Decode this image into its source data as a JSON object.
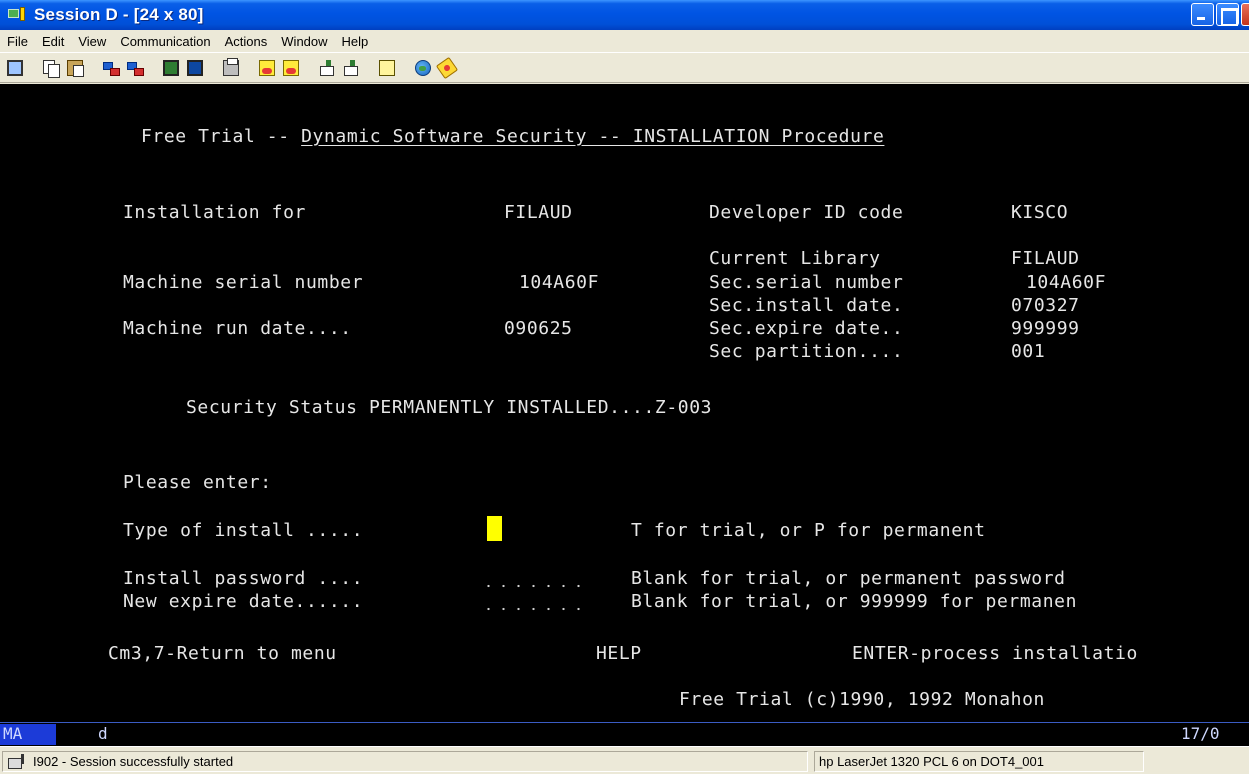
{
  "window": {
    "title": "Session D - [24 x 80]",
    "colors": {
      "titlebar": "#0054e3",
      "terminal_bg": "#000000",
      "terminal_fg": "#e6e6e6",
      "cursor": "#ffff00",
      "oia_highlight": "#1c3bd8"
    }
  },
  "menu": [
    "File",
    "Edit",
    "View",
    "Communication",
    "Actions",
    "Window",
    "Help"
  ],
  "toolbar": {
    "icons": [
      "monitor-icon",
      "copy-icon",
      "paste-icon",
      "connect-icon",
      "disconnect-icon",
      "screen-green-icon",
      "screen-blue-icon",
      "print-screen-icon",
      "record-macro-icon",
      "stop-macro-icon",
      "play-macro-icon",
      "pause-macro-icon",
      "clipboard-icon",
      "globe-icon",
      "tag-icon"
    ]
  },
  "screen": {
    "header_prefix": "Free Trial -- ",
    "header_underlined": "Dynamic Software Security -- INSTALLATION Procedure",
    "installation_for_label": "Installation for",
    "installation_for_value": "FILAUD",
    "developer_id_label": "Developer ID code",
    "developer_id_value": "KISCO",
    "current_library_label": "Current Library",
    "current_library_value": "FILAUD",
    "machine_serial_label": "Machine serial number",
    "machine_serial_value": "104A60F",
    "sec_serial_label": "Sec.serial number",
    "sec_serial_value": "104A60F",
    "sec_install_label": "Sec.install date.",
    "sec_install_value": "070327",
    "machine_run_label": "Machine run date....",
    "machine_run_value": "090625",
    "sec_expire_label": "Sec.expire date..",
    "sec_expire_value": "999999",
    "sec_partition_label": "Sec partition....",
    "sec_partition_value": "001",
    "security_status": "Security Status PERMANENTLY INSTALLED....Z-003",
    "please_enter": "Please enter:",
    "type_install_label": "Type of install .....",
    "type_install_hint": "T for trial, or P for permanent",
    "install_password_label": "Install password ....",
    "install_password_hint": "Blank for trial, or permanent password",
    "new_expire_label": "New expire date......",
    "new_expire_hint": "Blank for trial, or 999999 for permanen",
    "fkey_return": "Cm3,7-Return to menu",
    "fkey_help": "HELP",
    "fkey_enter": "ENTER-process installatio",
    "copyright": "Free Trial (c)1990, 1992 Monahon"
  },
  "oia": {
    "mode": "MA",
    "indicator": "d",
    "cursor_position": "17/0"
  },
  "status": {
    "message": "I902 - Session successfully started",
    "printer": "hp LaserJet 1320 PCL 6 on DOT4_001"
  }
}
